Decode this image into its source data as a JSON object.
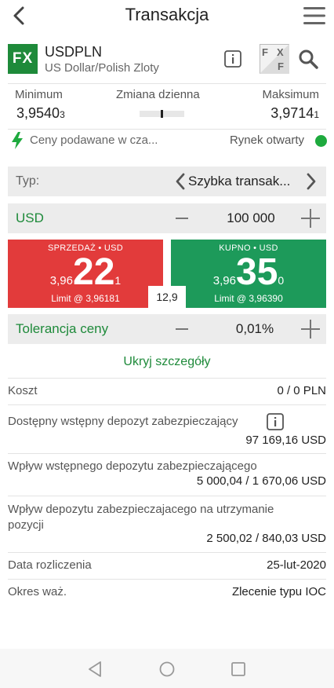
{
  "header": {
    "title": "Transakcja",
    "back_icon": "back-arrow-icon",
    "menu_icon": "hamburger-menu-icon"
  },
  "instrument": {
    "badge": "FX",
    "symbol": "USDPLN",
    "name": "US Dollar/Polish Zloty",
    "fxf_badge_letters": [
      "F",
      "X",
      "F"
    ]
  },
  "stats": {
    "min_label": "Minimum",
    "min_value": "3,9540",
    "min_pip": "3",
    "change_label": "Zmiana dzienna",
    "change_marker": 0.5,
    "max_label": "Maksimum",
    "max_value": "3,9714",
    "max_pip": "1"
  },
  "status": {
    "price_info": "Ceny podawane w cza...",
    "market": "Rynek otwarty",
    "market_color": "#1eaa3e"
  },
  "type": {
    "label": "Typ:",
    "value": "Szybka transak..."
  },
  "amount": {
    "currency": "USD",
    "value": "100 000"
  },
  "sell": {
    "header": "SPRZEDAŻ • USD",
    "prefix": "3,96",
    "main": "22",
    "suffix": "1",
    "limit": "Limit @ 3,96181",
    "color": "#e23b3b"
  },
  "buy": {
    "header": "KUPNO • USD",
    "prefix": "3,96",
    "main": "35",
    "suffix": "0",
    "limit": "Limit @ 3,96390",
    "color": "#1d9a5a"
  },
  "spread": "12,9",
  "tolerance": {
    "label": "Tolerancja ceny",
    "value": "0,01%"
  },
  "toggle_details": "Ukryj szczegóły",
  "details": {
    "cost_label": "Koszt",
    "cost_value": "0 / 0 PLN",
    "margin_label": "Dostępny wstępny depozyt zabezpieczający",
    "margin_value": "97 169,16 USD",
    "impact_label": "Wpływ wstępnego depozytu zabezpieczającego",
    "impact_value": "5 000,04 / 1 670,06 USD",
    "maint_label": "Wpływ depozytu zabezpieczajacego na utrzymanie pozycji",
    "maint_value": "2 500,02 / 840,03 USD",
    "settle_label": "Data rozliczenia",
    "settle_value": "25-lut-2020",
    "validity_label": "Okres waż.",
    "validity_value": "Zlecenie typu IOC"
  }
}
